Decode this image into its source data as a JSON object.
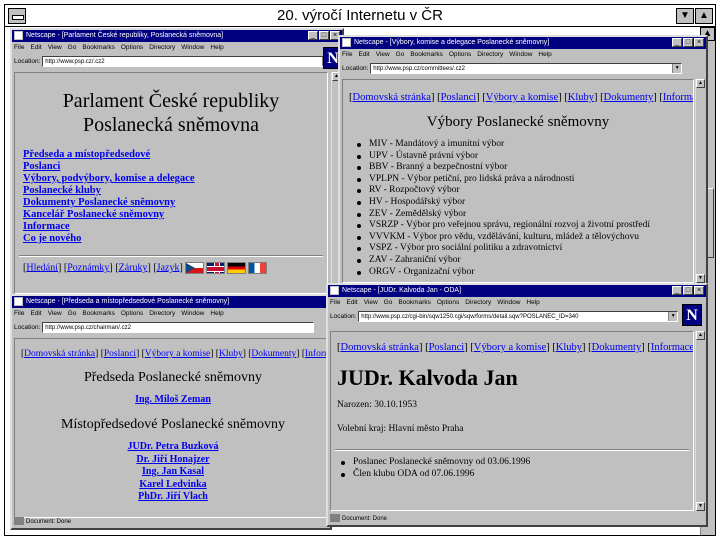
{
  "outer": {
    "title": "20. výročí Internetu v ČR"
  },
  "menu_items": [
    "File",
    "Edit",
    "View",
    "Go",
    "Bookmarks",
    "Options",
    "Directory",
    "Window",
    "Help"
  ],
  "location_label": "Location:",
  "brand_letter": "N",
  "w1": {
    "title": "Netscape - [Parlament České republiky, Poslanecká sněmovna]",
    "url": "http://www.psp.cz/.cz2",
    "heading1": "Parlament České republiky",
    "heading2": "Poslanecká sněmovna",
    "links": [
      "Předseda a místopředsedové",
      "Poslanci",
      "Výbory, podvýbory, komise a delegace",
      "Poslanecké kluby",
      "Dokumenty Poslanecké sněmovny",
      "Kancelář Poslanecké sněmovny",
      "Informace",
      "Co je nového"
    ],
    "nav": [
      "Hledání",
      "Poznámky",
      "Záruky",
      "Jazyk"
    ]
  },
  "w2": {
    "title": "Netscape - [Výbory, komise a delegace Poslanecké sněmovny]",
    "url": "http://www.psp.cz/committees/.cz2",
    "nav": [
      "Domovská stránka",
      "Poslanci",
      "Výbory a komise",
      "Kluby",
      "Dokumenty",
      "Informace"
    ],
    "heading": "Výbory Poslanecké sněmovny",
    "items": [
      "MIV - Mandátový a imunitní výbor",
      "UPV - Ústavně právní výbor",
      "BBV - Branný a bezpečnostní výbor",
      "VPLPN - Výbor petiční, pro lidská práva a národnosti",
      "RV - Rozpočtový výbor",
      "HV - Hospodářský výbor",
      "ZEV - Zemědělský výbor",
      "VSRZP - Výbor pro veřejnou správu, regionální rozvoj a životní prostředí",
      "VVVKM - Výbor pro vědu, vzdělávání, kulturu, mládež a tělovýchovu",
      "VSPZ - Výbor pro sociální politiku a zdravotnictví",
      "ZAV - Zahraniční výbor",
      "ORGV - Organizační výbor"
    ]
  },
  "w3": {
    "title": "Netscape - [Předseda a místopředsedové Poslanecké sněmovny]",
    "url": "http://www.psp.cz/chairman/.cz2",
    "nav": [
      "Domovská stránka",
      "Poslanci",
      "Výbory a komise",
      "Kluby",
      "Dokumenty",
      "Informace"
    ],
    "heading1": "Předseda Poslanecké sněmovny",
    "chairman": "Ing. Miloš Zeman",
    "heading2": "Místopředsedové Poslanecké sněmovny",
    "vice": [
      "JUDr. Petra Buzková",
      "Dr. Jiří Honajzer",
      "Ing. Jan Kasal",
      "Karel Ledvinka",
      "PhDr. Jiří Vlach"
    ],
    "status": "Document: Done"
  },
  "w4": {
    "title": "Netscape - [JUDr. Kalvoda Jan - ODA]",
    "url": "http://www.psp.cz/cgi-bin/sqw1250.cgi/sqw/forms/detail.sqw?POSLANEC_ID=340",
    "nav": [
      "Domovská stránka",
      "Poslanci",
      "Výbory a komise",
      "Kluby",
      "Dokumenty",
      "Informace"
    ],
    "name": "JUDr. Kalvoda Jan",
    "born": "Narozen: 30.10.1953",
    "district": "Volební kraj: Hlavní město Praha",
    "facts": [
      "Poslanec Poslanecké sněmovny od 03.06.1996",
      "Člen klubu ODA od 07.06.1996"
    ],
    "status": "Document: Done"
  }
}
